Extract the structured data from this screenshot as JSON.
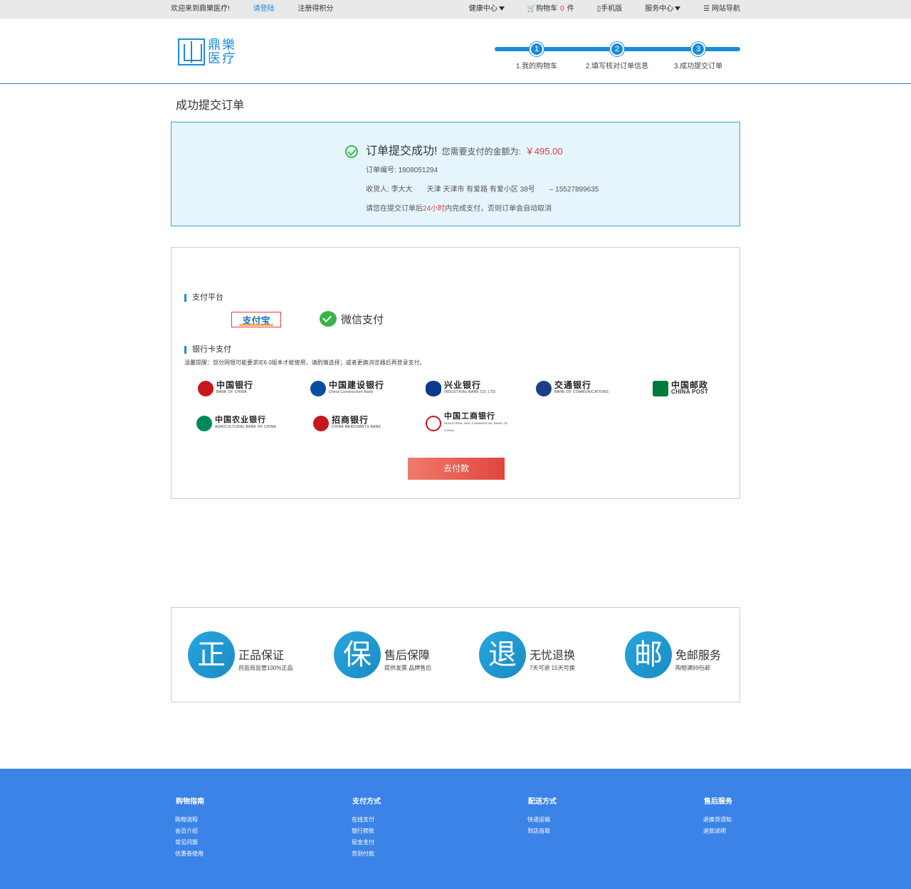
{
  "topbar": {
    "welcome": "欢迎来到鼎樂医疗!",
    "login": "请登陆",
    "register": "注册得积分",
    "health_center": "健康中心",
    "cart_label": "购物车",
    "cart_count": "0",
    "cart_unit": "件",
    "mobile": "手机版",
    "service_center": "服务中心",
    "site_nav": "网站导航"
  },
  "logo": {
    "text": "鼎樂医疗"
  },
  "steps": [
    {
      "num": "1",
      "label": "1.我的购物车"
    },
    {
      "num": "2",
      "label": "2.填写核对订单信息"
    },
    {
      "num": "3",
      "label": "3.成功提交订单"
    }
  ],
  "page_title": "成功提交订单",
  "success": {
    "title": "订单提交成功!",
    "need_pay": "您需要支付的金额为:",
    "amount": "￥495.00",
    "order_no_label": "订单编号:",
    "order_no": "1808051294",
    "receiver_label": "收货人:",
    "receiver": "李大大",
    "address": "天津 天津市 有爱路 有爱小区 38号",
    "phone": "– 15527899635",
    "notice_pre": "请您在提交订单后",
    "notice_time": "24小时",
    "notice_post": "内完成支付，否则订单会自动取消"
  },
  "payment": {
    "platform_title": "支付平台",
    "alipay": "支付宝",
    "wechat": "微信支付",
    "bank_title": "银行卡支付",
    "notice": "温馨提醒：部分网银可能要求IE6.0版本才能使用，请酌情选择；或者更换浏览器后再登录支付。",
    "banks": [
      {
        "cn": "中国银行",
        "en": "BANK OF CHINA",
        "color": "#c8161d"
      },
      {
        "cn": "中国建设银行",
        "en": "China Construction Bank",
        "color": "#0a4ea2"
      },
      {
        "cn": "兴业银行",
        "en": "INDUSTRIAL BANK CO.,LTD.",
        "color": "#0b3a8f"
      },
      {
        "cn": "交通银行",
        "en": "BANK OF COMMUNICATIONS",
        "color": "#1d3f8a"
      },
      {
        "cn": "中国邮政",
        "en": "CHINA POST",
        "color": "#007a3d"
      },
      {
        "cn": "中国农业银行",
        "en": "AGRICULTURAL BANK OF CHINA",
        "color": "#00875a"
      },
      {
        "cn": "招商银行",
        "en": "CHINA MERCHANTS BANK",
        "color": "#c8161d"
      },
      {
        "cn": "中国工商银行",
        "en": "INDUSTRIAL AND COMMERCIAL BANK OF CHINA",
        "color": "#c8161d"
      }
    ],
    "pay_button": "去付款"
  },
  "guarantees": [
    {
      "char": "正",
      "title": "正品保证",
      "desc": "药监局监管100%正品"
    },
    {
      "char": "保",
      "title": "售后保障",
      "desc": "提供发票 品牌售后"
    },
    {
      "char": "退",
      "title": "无忧退换",
      "desc": "7天可退 15天可换"
    },
    {
      "char": "邮",
      "title": "免邮服务",
      "desc": "购物满99包邮"
    }
  ],
  "footer": [
    {
      "title": "购物指南",
      "items": [
        "购物流程",
        "会员介绍",
        "常见问题",
        "优惠卷使用"
      ]
    },
    {
      "title": "支付方式",
      "items": [
        "在线支付",
        "银行转账",
        "现金支付",
        "货到付款"
      ]
    },
    {
      "title": "配送方式",
      "items": [
        "快递运输",
        "到店自取"
      ]
    },
    {
      "title": "售后服务",
      "items": [
        "退换货须知",
        "退款说明"
      ]
    }
  ],
  "colors": {
    "accent": "#1c8bd8",
    "price_red": "#e4393c",
    "footer_bg": "#3c83e8"
  }
}
